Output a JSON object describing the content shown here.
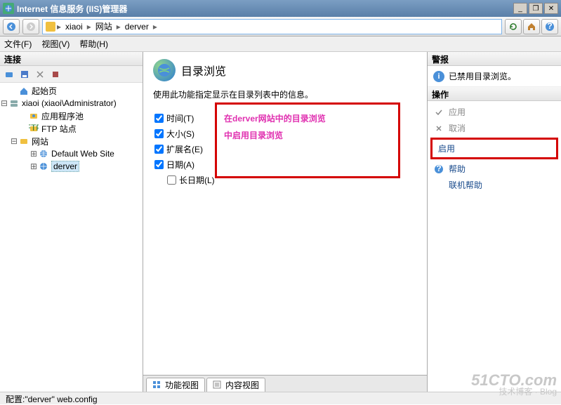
{
  "window": {
    "title": "Internet 信息服务 (IIS)管理器"
  },
  "breadcrumb": {
    "items": [
      "xiaoi",
      "网站",
      "derver"
    ]
  },
  "menus": {
    "file": "文件(F)",
    "view": "视图(V)",
    "help": "帮助(H)"
  },
  "connections": {
    "header": "连接",
    "nodes": {
      "start": "起始页",
      "server": "xiaoi (xiaoi\\Administrator)",
      "apppools": "应用程序池",
      "ftpsites": "FTP 站点",
      "sites": "网站",
      "defaultsite": "Default Web Site",
      "derver": "derver"
    }
  },
  "content": {
    "title": "目录浏览",
    "description": "使用此功能指定显示在目录列表中的信息。",
    "checks": {
      "time": "时间(T)",
      "size": "大小(S)",
      "ext": "扩展名(E)",
      "date": "日期(A)",
      "longdate": "长日期(L)"
    },
    "tabs": {
      "features": "功能视图",
      "content": "内容视图"
    }
  },
  "annotation": {
    "line1": "在derver网站中的目录浏览",
    "line2": "中启用目录浏览"
  },
  "alerts": {
    "header": "警报",
    "disabled": "已禁用目录浏览。"
  },
  "actions": {
    "header": "操作",
    "apply": "应用",
    "cancel": "取消",
    "enable": "启用",
    "help": "帮助",
    "onlinehelp": "联机帮助"
  },
  "status": {
    "text": "配置:\"derver\" web.config"
  },
  "watermark": {
    "big": "51CTO.com",
    "small": "技术博客 · Blog"
  }
}
